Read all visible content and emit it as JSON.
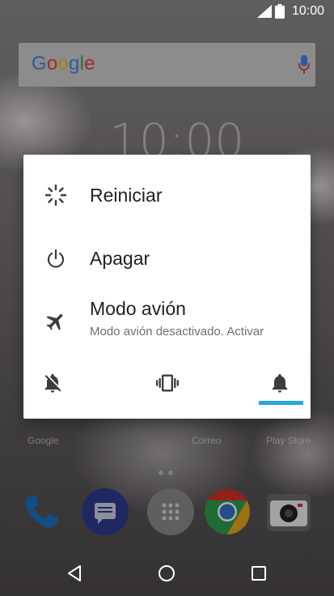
{
  "status_bar": {
    "time": "10:00",
    "icons": [
      "signal-icon",
      "battery-icon"
    ]
  },
  "search_bar": {
    "logo_text": "Google",
    "icons": [
      "mic-icon"
    ]
  },
  "background_clock": "10:00",
  "power_menu": {
    "items": [
      {
        "label": "Reiniciar",
        "icon": "restart-icon"
      },
      {
        "label": "Apagar",
        "icon": "power-icon"
      },
      {
        "label": "Modo avión",
        "sublabel": "Modo avión desactivado. Activar",
        "icon": "airplane-icon"
      }
    ],
    "sound_modes": [
      {
        "icon": "silent-icon"
      },
      {
        "icon": "vibrate-icon"
      },
      {
        "icon": "bell-icon",
        "selected": true
      }
    ],
    "accent_color": "#27a8e0"
  },
  "home": {
    "app_labels": [
      "Google",
      "Correo",
      "Play Store"
    ],
    "dock_icons": [
      "phone-icon",
      "messages-icon",
      "app-drawer-icon",
      "chrome-icon",
      "camera-icon"
    ]
  },
  "nav_bar": {
    "icons": [
      "back-icon",
      "home-icon",
      "recents-icon"
    ]
  }
}
